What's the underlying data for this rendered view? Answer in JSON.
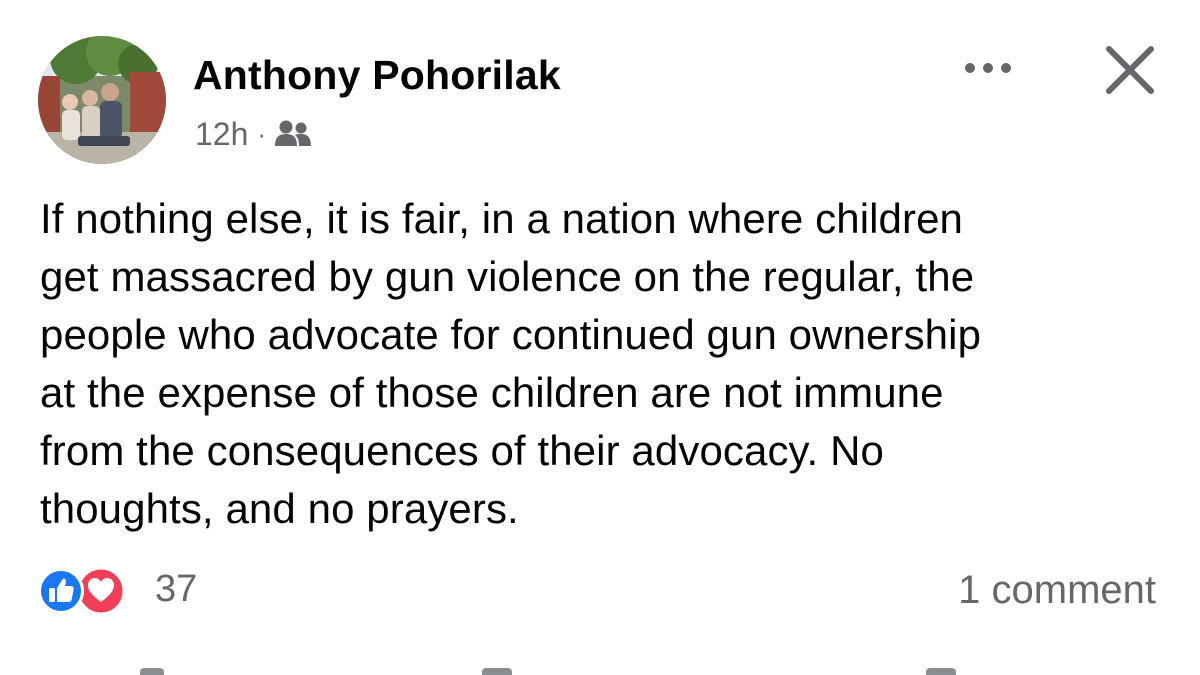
{
  "post": {
    "author": "Anthony Pohorilak",
    "time": "12h",
    "separator": "·",
    "audience_icon": "friends-icon",
    "body_lines": [
      "If nothing else, it is fair, in a nation where children",
      "get massacred by gun violence on the regular, the",
      "people who advocate for continued gun ownership",
      "at the expense of those children are not immune",
      "from the consequences of their advocacy. No",
      "thoughts, and no prayers."
    ],
    "reactions": {
      "types": [
        "like-icon",
        "love-icon"
      ],
      "count": "37"
    },
    "comments": "1 comment"
  },
  "colors": {
    "text": "#050505",
    "secondary": "#65676b",
    "like_blue": "#1877f2",
    "love_red": "#f33e58"
  }
}
